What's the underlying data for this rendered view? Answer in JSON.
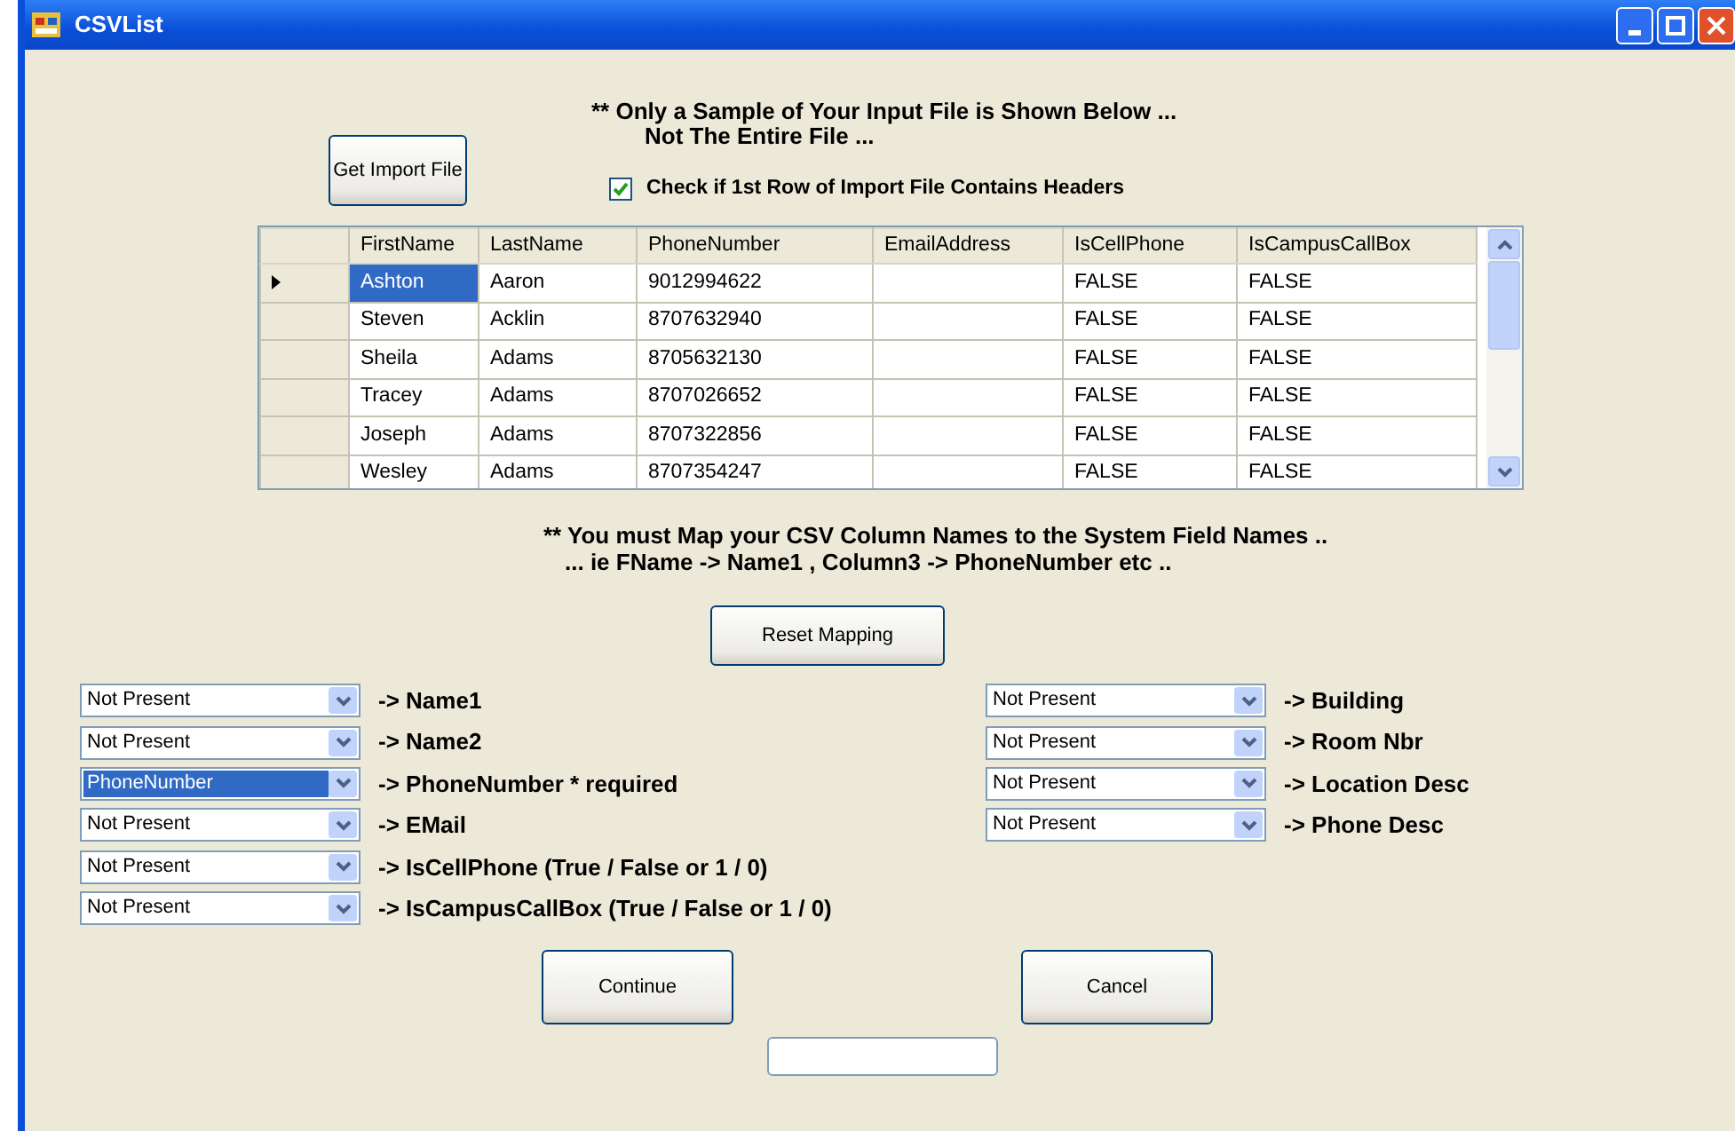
{
  "window": {
    "title": "CSVList"
  },
  "import_button": "Get Import File",
  "sample_notice": [
    "** Only a Sample of Your Input File is Shown Below ...",
    "Not The Entire File ..."
  ],
  "headers_checkbox": {
    "label": "Check if 1st Row of Import File Contains Headers",
    "checked": true
  },
  "grid": {
    "columns": [
      "FirstName",
      "LastName",
      "PhoneNumber",
      "EmailAddress",
      "IsCellPhone",
      "IsCampusCallBox"
    ],
    "rows": [
      {
        "selected": true,
        "cells": [
          "Ashton",
          "Aaron",
          "9012994622",
          "",
          "FALSE",
          "FALSE"
        ]
      },
      {
        "selected": false,
        "cells": [
          "Steven",
          "Acklin",
          "8707632940",
          "",
          "FALSE",
          "FALSE"
        ]
      },
      {
        "selected": false,
        "cells": [
          "Sheila",
          "Adams",
          "8705632130",
          "",
          "FALSE",
          "FALSE"
        ]
      },
      {
        "selected": false,
        "cells": [
          "Tracey",
          "Adams",
          "8707026652",
          "",
          "FALSE",
          "FALSE"
        ]
      },
      {
        "selected": false,
        "cells": [
          "Joseph",
          "Adams",
          "8707322856",
          "",
          "FALSE",
          "FALSE"
        ]
      },
      {
        "selected": false,
        "cells": [
          "Wesley",
          "Adams",
          "8707354247",
          "",
          "FALSE",
          "FALSE"
        ]
      }
    ]
  },
  "mapping_notice": [
    "** You must Map your CSV Column Names to the System Field Names ..",
    "... ie  FName -> Name1  ,  Column3 -> PhoneNumber etc .."
  ],
  "reset_button": "Reset Mapping",
  "mappings_left": [
    {
      "value": "Not Present",
      "focused": false,
      "target": "-> Name1"
    },
    {
      "value": "Not Present",
      "focused": false,
      "target": "-> Name2"
    },
    {
      "value": "PhoneNumber",
      "focused": true,
      "target": "-> PhoneNumber * required"
    },
    {
      "value": "Not Present",
      "focused": false,
      "target": "-> EMail"
    },
    {
      "value": "Not Present",
      "focused": false,
      "target": "-> IsCellPhone (True / False or 1 / 0)"
    },
    {
      "value": "Not Present",
      "focused": false,
      "target": "-> IsCampusCallBox (True / False or 1 / 0)"
    }
  ],
  "mappings_right": [
    {
      "value": "Not Present",
      "focused": false,
      "target": "-> Building"
    },
    {
      "value": "Not Present",
      "focused": false,
      "target": "-> Room Nbr"
    },
    {
      "value": "Not Present",
      "focused": false,
      "target": "-> Location Desc"
    },
    {
      "value": "Not Present",
      "focused": false,
      "target": "-> Phone Desc"
    }
  ],
  "buttons": [
    "Continue",
    "Cancel"
  ]
}
